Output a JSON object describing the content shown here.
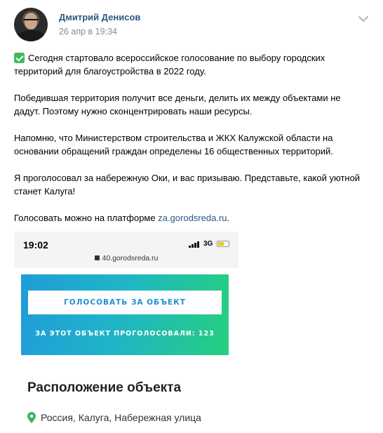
{
  "post": {
    "author": "Дмитрий Денисов",
    "date": "26 апр в 19:34",
    "paragraphs": [
      "Сегодня стартовало всероссийское голосование по выбору городских территорий для благоустройства в 2022 году.",
      "Победившая территория получит все деньги, делить их между объектами не дадут. Поэтому нужно сконцентрировать наши ресурсы.",
      "Напомню, что Министерством строительства и ЖКХ Калужской области на основании обращений граждан определены 16 общественных территорий.",
      "Я проголосовал за набережную Оки, и вас призываю. Представьте, какой уютной станет Калуга!"
    ],
    "vote_prefix": "Голосовать можно на платформе ",
    "vote_link": "za.gorodsreda.ru",
    "vote_suffix": "."
  },
  "screenshot": {
    "time": "19:02",
    "network": "3G",
    "url": "40.gorodsreda.ru",
    "vote_button": "ГОЛОСОВАТЬ ЗА ОБЪЕКТ",
    "vote_count": "ЗА ЭТОТ ОБЪЕКТ ПРОГОЛОСОВАЛИ: 123",
    "location_title": "Расположение объекта",
    "location_address": "Россия, Калуга, Набережная улица"
  },
  "icons": {
    "check": "check-mark-icon",
    "menu": "chevron-down-icon",
    "pin": "map-pin-icon"
  },
  "colors": {
    "link": "#2a5885",
    "check": "#43b95c",
    "banner_start": "#1f9cd9",
    "banner_end": "#26cf7e",
    "pin": "#3cb563"
  }
}
